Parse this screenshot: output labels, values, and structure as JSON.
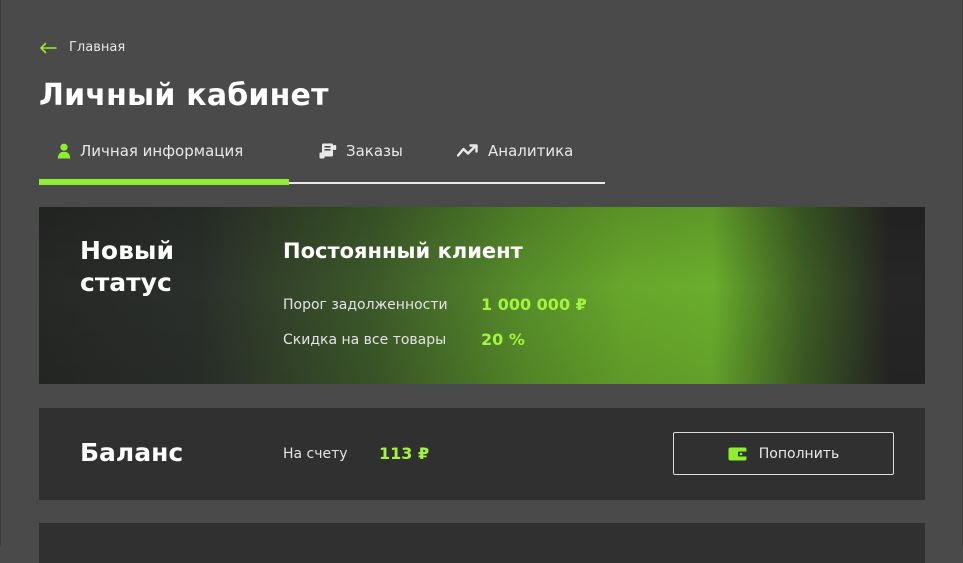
{
  "breadcrumb": {
    "label": "Главная",
    "icon": "arrow-left-icon"
  },
  "page_title": "Личный кабинет",
  "tabs": [
    {
      "label": "Личная информация",
      "icon": "user-icon",
      "active": true
    },
    {
      "label": "Заказы",
      "icon": "receipt-icon",
      "active": false
    },
    {
      "label": "Аналитика",
      "icon": "trend-icon",
      "active": false
    }
  ],
  "status": {
    "heading": "Новый статус",
    "name": "Постоянный клиент",
    "debt_threshold_label": "Порог задолженности",
    "debt_threshold_value": "1 000 000 ₽",
    "discount_label": "Скидка на все товары",
    "discount_value": "20 %"
  },
  "balance": {
    "title": "Баланс",
    "label": "На счету",
    "value": "113 ₽",
    "topup_label": "Пополнить",
    "topup_icon": "wallet-icon"
  },
  "colors": {
    "accent": "#8fef2f",
    "value_green": "#a4f33c",
    "background": "#4a4a4a",
    "card": "#303030"
  }
}
